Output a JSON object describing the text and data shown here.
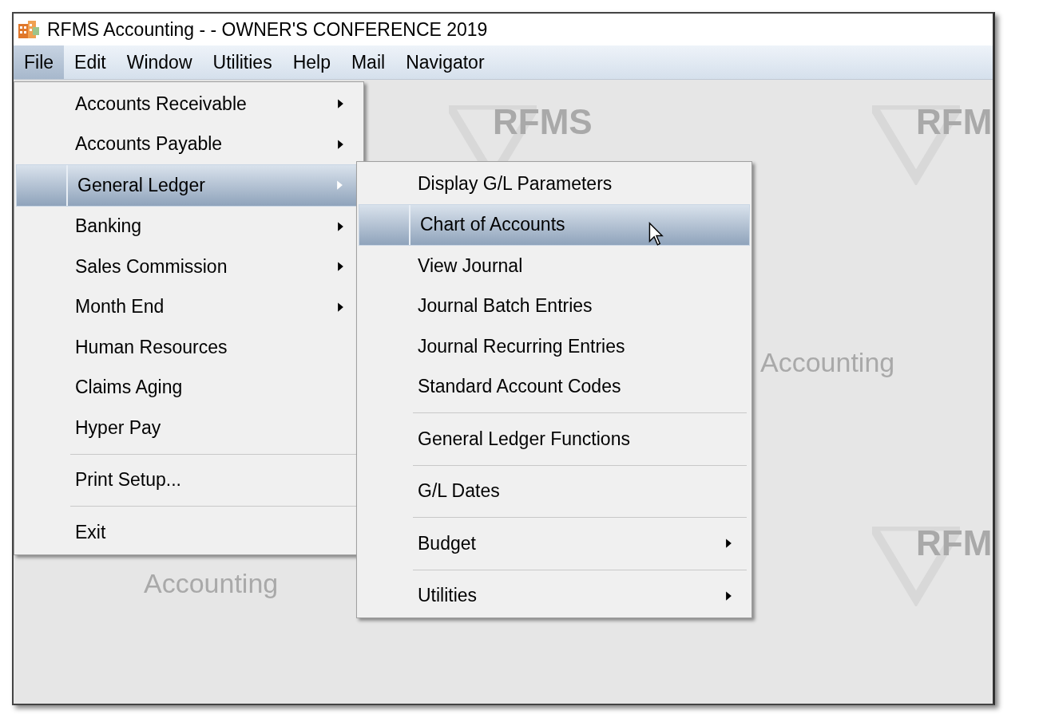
{
  "window": {
    "title": "RFMS Accounting  - - OWNER'S CONFERENCE 2019"
  },
  "menubar": [
    {
      "label": "File",
      "selected": true
    },
    {
      "label": "Edit",
      "selected": false
    },
    {
      "label": "Window",
      "selected": false
    },
    {
      "label": "Utilities",
      "selected": false
    },
    {
      "label": "Help",
      "selected": false
    },
    {
      "label": "Mail",
      "selected": false
    },
    {
      "label": "Navigator",
      "selected": false
    }
  ],
  "wallpaper": [
    {
      "kind": "brand",
      "text": "RFMS"
    },
    {
      "kind": "tagline",
      "text": "Accounting"
    },
    {
      "kind": "tagline",
      "text": "Accounting"
    },
    {
      "kind": "brand",
      "text": "RFM"
    },
    {
      "kind": "brand",
      "text": "RFM"
    }
  ],
  "file_menu": [
    {
      "kind": "item",
      "label": "Accounts Receivable",
      "submenu": true,
      "selected": false
    },
    {
      "kind": "item",
      "label": "Accounts Payable",
      "submenu": true,
      "selected": false
    },
    {
      "kind": "item",
      "label": "General Ledger",
      "submenu": true,
      "selected": true
    },
    {
      "kind": "item",
      "label": "Banking",
      "submenu": true,
      "selected": false
    },
    {
      "kind": "item",
      "label": "Sales Commission",
      "submenu": true,
      "selected": false
    },
    {
      "kind": "item",
      "label": "Month End",
      "submenu": true,
      "selected": false
    },
    {
      "kind": "item",
      "label": "Human Resources",
      "submenu": false,
      "selected": false
    },
    {
      "kind": "item",
      "label": "Claims Aging",
      "submenu": false,
      "selected": false
    },
    {
      "kind": "item",
      "label": "Hyper Pay",
      "submenu": false,
      "selected": false
    },
    {
      "kind": "separator"
    },
    {
      "kind": "item",
      "label": "Print Setup...",
      "submenu": false,
      "selected": false
    },
    {
      "kind": "separator"
    },
    {
      "kind": "item",
      "label": "Exit",
      "submenu": false,
      "selected": false
    }
  ],
  "general_ledger_menu": [
    {
      "kind": "item",
      "label": "Display G/L Parameters",
      "submenu": false,
      "selected": false
    },
    {
      "kind": "item",
      "label": "Chart of Accounts",
      "submenu": false,
      "selected": true
    },
    {
      "kind": "item",
      "label": "View Journal",
      "submenu": false,
      "selected": false
    },
    {
      "kind": "item",
      "label": "Journal Batch Entries",
      "submenu": false,
      "selected": false
    },
    {
      "kind": "item",
      "label": "Journal Recurring Entries",
      "submenu": false,
      "selected": false
    },
    {
      "kind": "item",
      "label": "Standard Account Codes",
      "submenu": false,
      "selected": false
    },
    {
      "kind": "separator"
    },
    {
      "kind": "item",
      "label": "General Ledger Functions",
      "submenu": false,
      "selected": false
    },
    {
      "kind": "separator"
    },
    {
      "kind": "item",
      "label": "G/L  Dates",
      "submenu": false,
      "selected": false
    },
    {
      "kind": "separator"
    },
    {
      "kind": "item",
      "label": "Budget",
      "submenu": true,
      "selected": false
    },
    {
      "kind": "separator"
    },
    {
      "kind": "item",
      "label": "Utilities",
      "submenu": true,
      "selected": false
    }
  ]
}
